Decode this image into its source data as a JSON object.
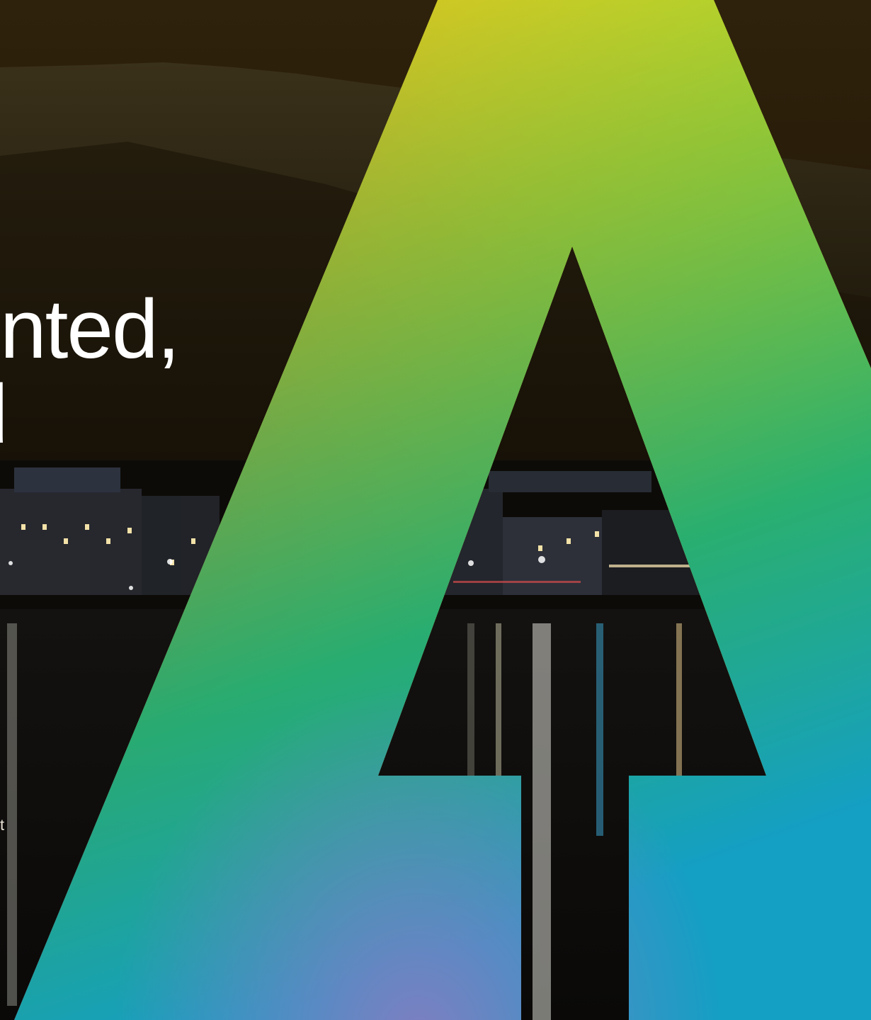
{
  "hero": {
    "headline_line_1": "nted,",
    "headline_line_2": "d",
    "side_text_fragment": "t"
  },
  "logo": {
    "letter": "A",
    "icon": "rainbow-a-logo-icon",
    "gradient_colors": [
      "#f7e21a",
      "#f5c418",
      "#f0921e",
      "#e8223f",
      "#c45a8c",
      "#2db35e",
      "#19a88e",
      "#1599c8"
    ]
  },
  "background": {
    "description_icon": "night-lakeside-city-icon",
    "sky_color": "#2a1d0a",
    "mountain_color": "#2c2411",
    "water_color": "#0f0e0c"
  }
}
